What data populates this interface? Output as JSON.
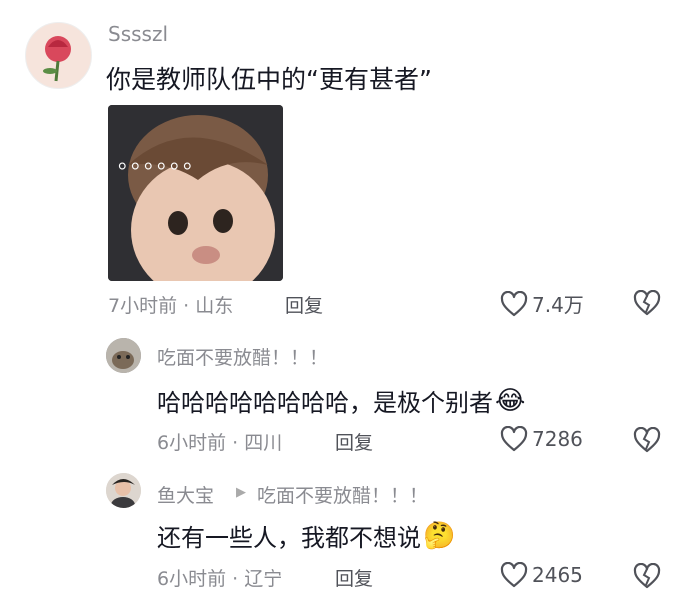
{
  "comments": [
    {
      "username": "Sssszl",
      "text": "你是教师队伍中的“更有甚者”",
      "sticker_caption": "。。。。。。",
      "meta": "7小时前 · 山东",
      "reply_label": "回复",
      "likes": "7.4万"
    }
  ],
  "replies": [
    {
      "username": "吃面不要放醋！！！",
      "text": "哈哈哈哈哈哈哈哈，是极个别者",
      "emoji": "😂",
      "meta": "6小时前 · 四川",
      "reply_label": "回复",
      "likes": "7286"
    },
    {
      "username": "鱼大宝",
      "reply_to": "吃面不要放醋！！！",
      "text": "还有一些人，我都不想说",
      "emoji": "🤔",
      "meta": "6小时前 · 辽宁",
      "reply_label": "回复",
      "likes": "2465"
    }
  ],
  "icons": {
    "like": "heart-outline-icon",
    "dislike": "broken-heart-icon",
    "reply_arrow": "triangle-right-icon"
  },
  "colors": {
    "text": "#161823",
    "meta": "#8a8b91",
    "icon": "#505259"
  }
}
